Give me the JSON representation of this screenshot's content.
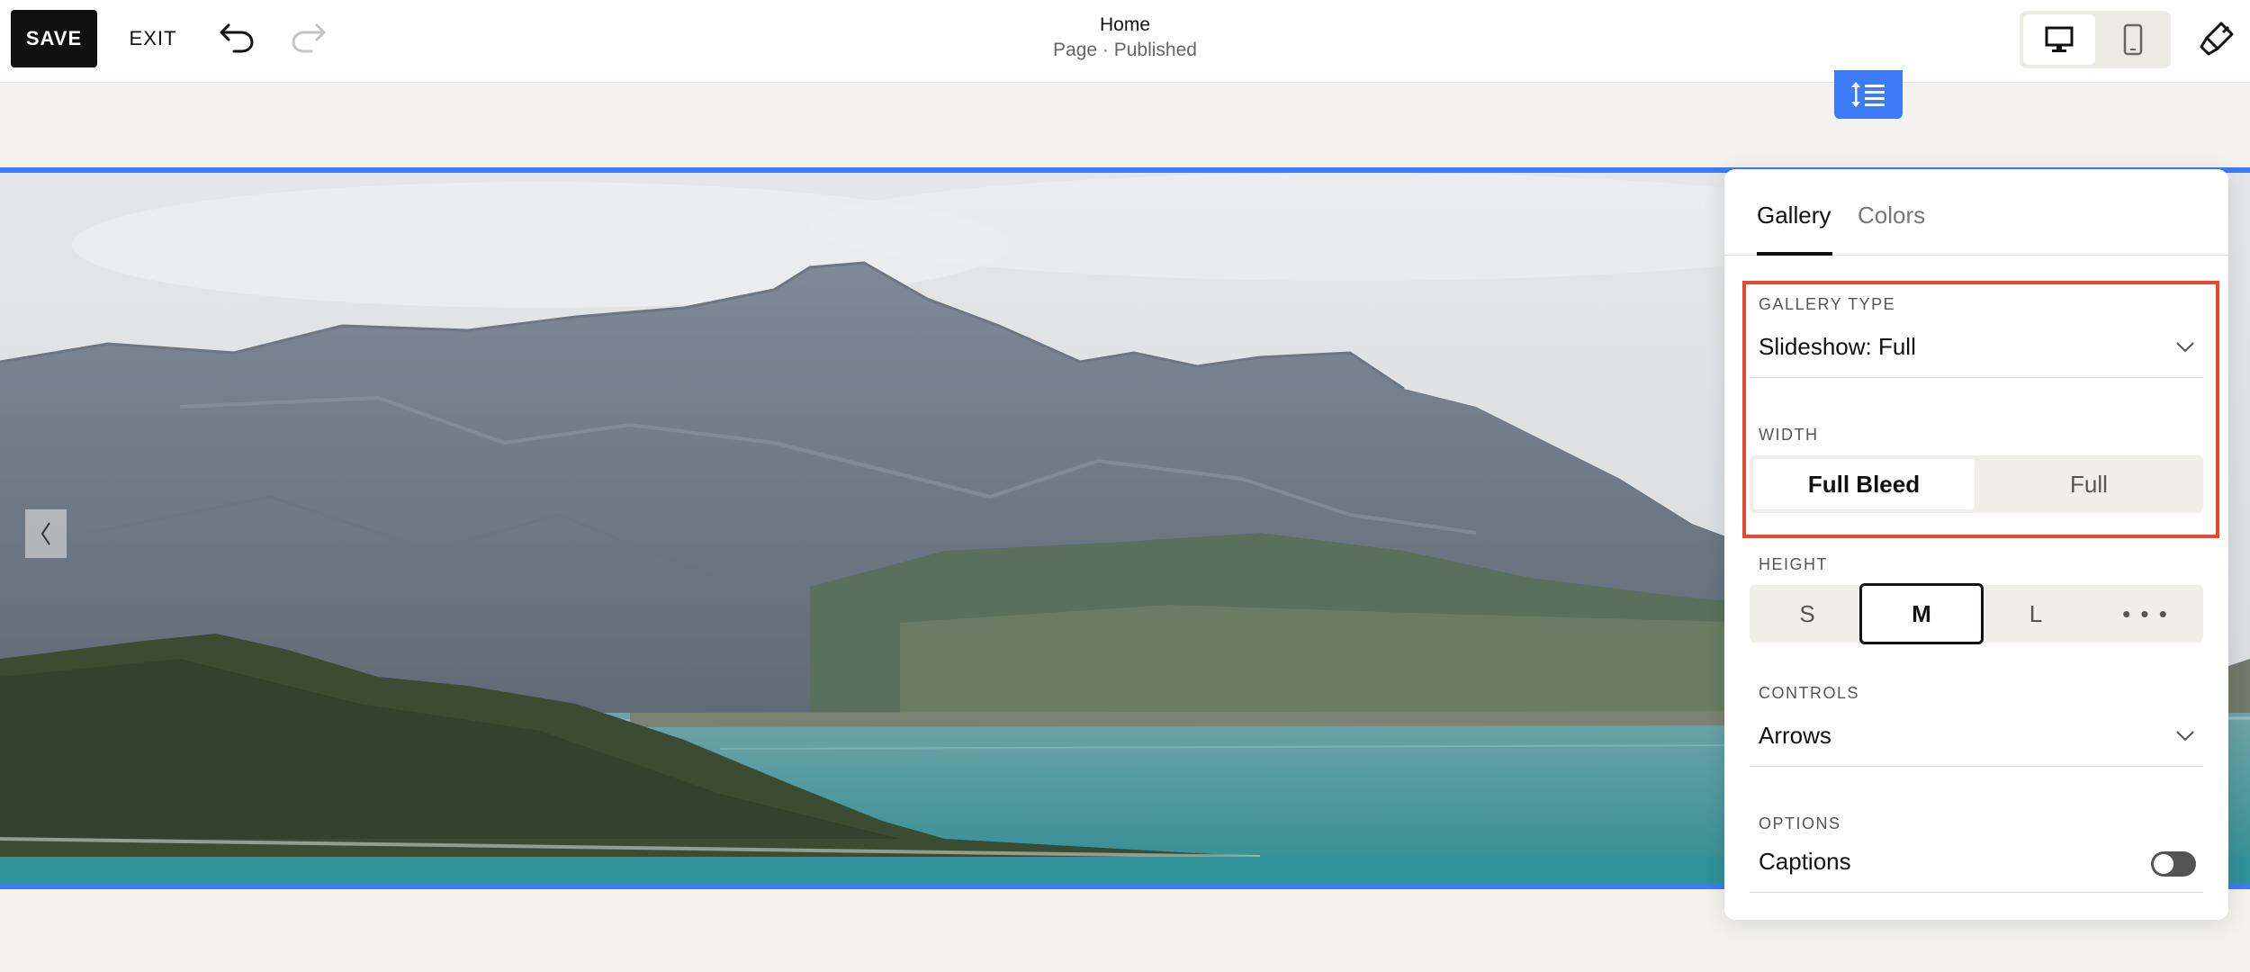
{
  "toolbar": {
    "save_label": "SAVE",
    "exit_label": "EXIT",
    "undo_icon": "undo-icon",
    "redo_icon": "redo-icon"
  },
  "header": {
    "title": "Home",
    "subtitle": "Page · Published"
  },
  "device_toggle": {
    "selected": "desktop",
    "options": [
      "desktop-icon",
      "mobile-icon"
    ]
  },
  "section_handle_icon": "section-height-icon",
  "gallery": {
    "prev_arrow": "‹"
  },
  "panel": {
    "tabs": [
      {
        "label": "Gallery",
        "active": true
      },
      {
        "label": "Colors",
        "active": false
      }
    ],
    "gallery_type": {
      "label": "GALLERY TYPE",
      "value": "Slideshow: Full"
    },
    "width": {
      "label": "WIDTH",
      "options": [
        "Full Bleed",
        "Full"
      ],
      "selected": "Full Bleed"
    },
    "height": {
      "label": "HEIGHT",
      "options": [
        "S",
        "M",
        "L",
        "• • •"
      ],
      "selected": "M"
    },
    "controls": {
      "label": "CONTROLS",
      "value": "Arrows"
    },
    "options": {
      "label": "OPTIONS",
      "captions_label": "Captions",
      "captions_enabled": false
    }
  },
  "colors": {
    "accent": "#3d7af5",
    "highlight": "#e8472f"
  }
}
